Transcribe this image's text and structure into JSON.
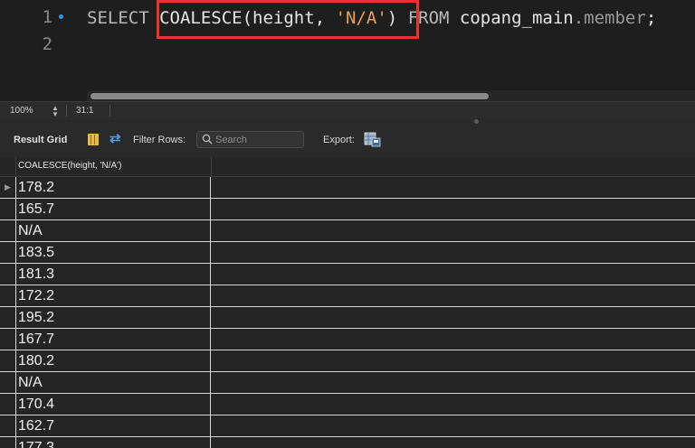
{
  "editor": {
    "line_numbers": [
      "1",
      "2"
    ],
    "query": {
      "kw_select": "SELECT ",
      "func": "COALESCE",
      "open_paren": "(",
      "col": "height",
      "comma": ", ",
      "literal": "'N/A'",
      "close_paren": ")",
      "space": " ",
      "kw_from": "FROM ",
      "schema": "copang_main",
      "dot_table": ".member",
      "semi": ";"
    }
  },
  "status": {
    "zoom": "100%",
    "cursor": "31:1"
  },
  "toolbar": {
    "result_grid_label": "Result Grid",
    "filter_label": "Filter Rows:",
    "search_placeholder": "Search",
    "export_label": "Export:"
  },
  "grid": {
    "column_header": "COALESCE(height, 'N/A')",
    "current_row_marker": "▶",
    "rows": [
      "178.2",
      "165.7",
      "N/A",
      "183.5",
      "181.3",
      "172.2",
      "195.2",
      "167.7",
      "180.2",
      "N/A",
      "170.4",
      "162.7",
      "177.3"
    ]
  },
  "colors": {
    "highlight_box": "#e8352c",
    "string_literal": "#e8a155",
    "accent_blue": "#2f95e6"
  }
}
